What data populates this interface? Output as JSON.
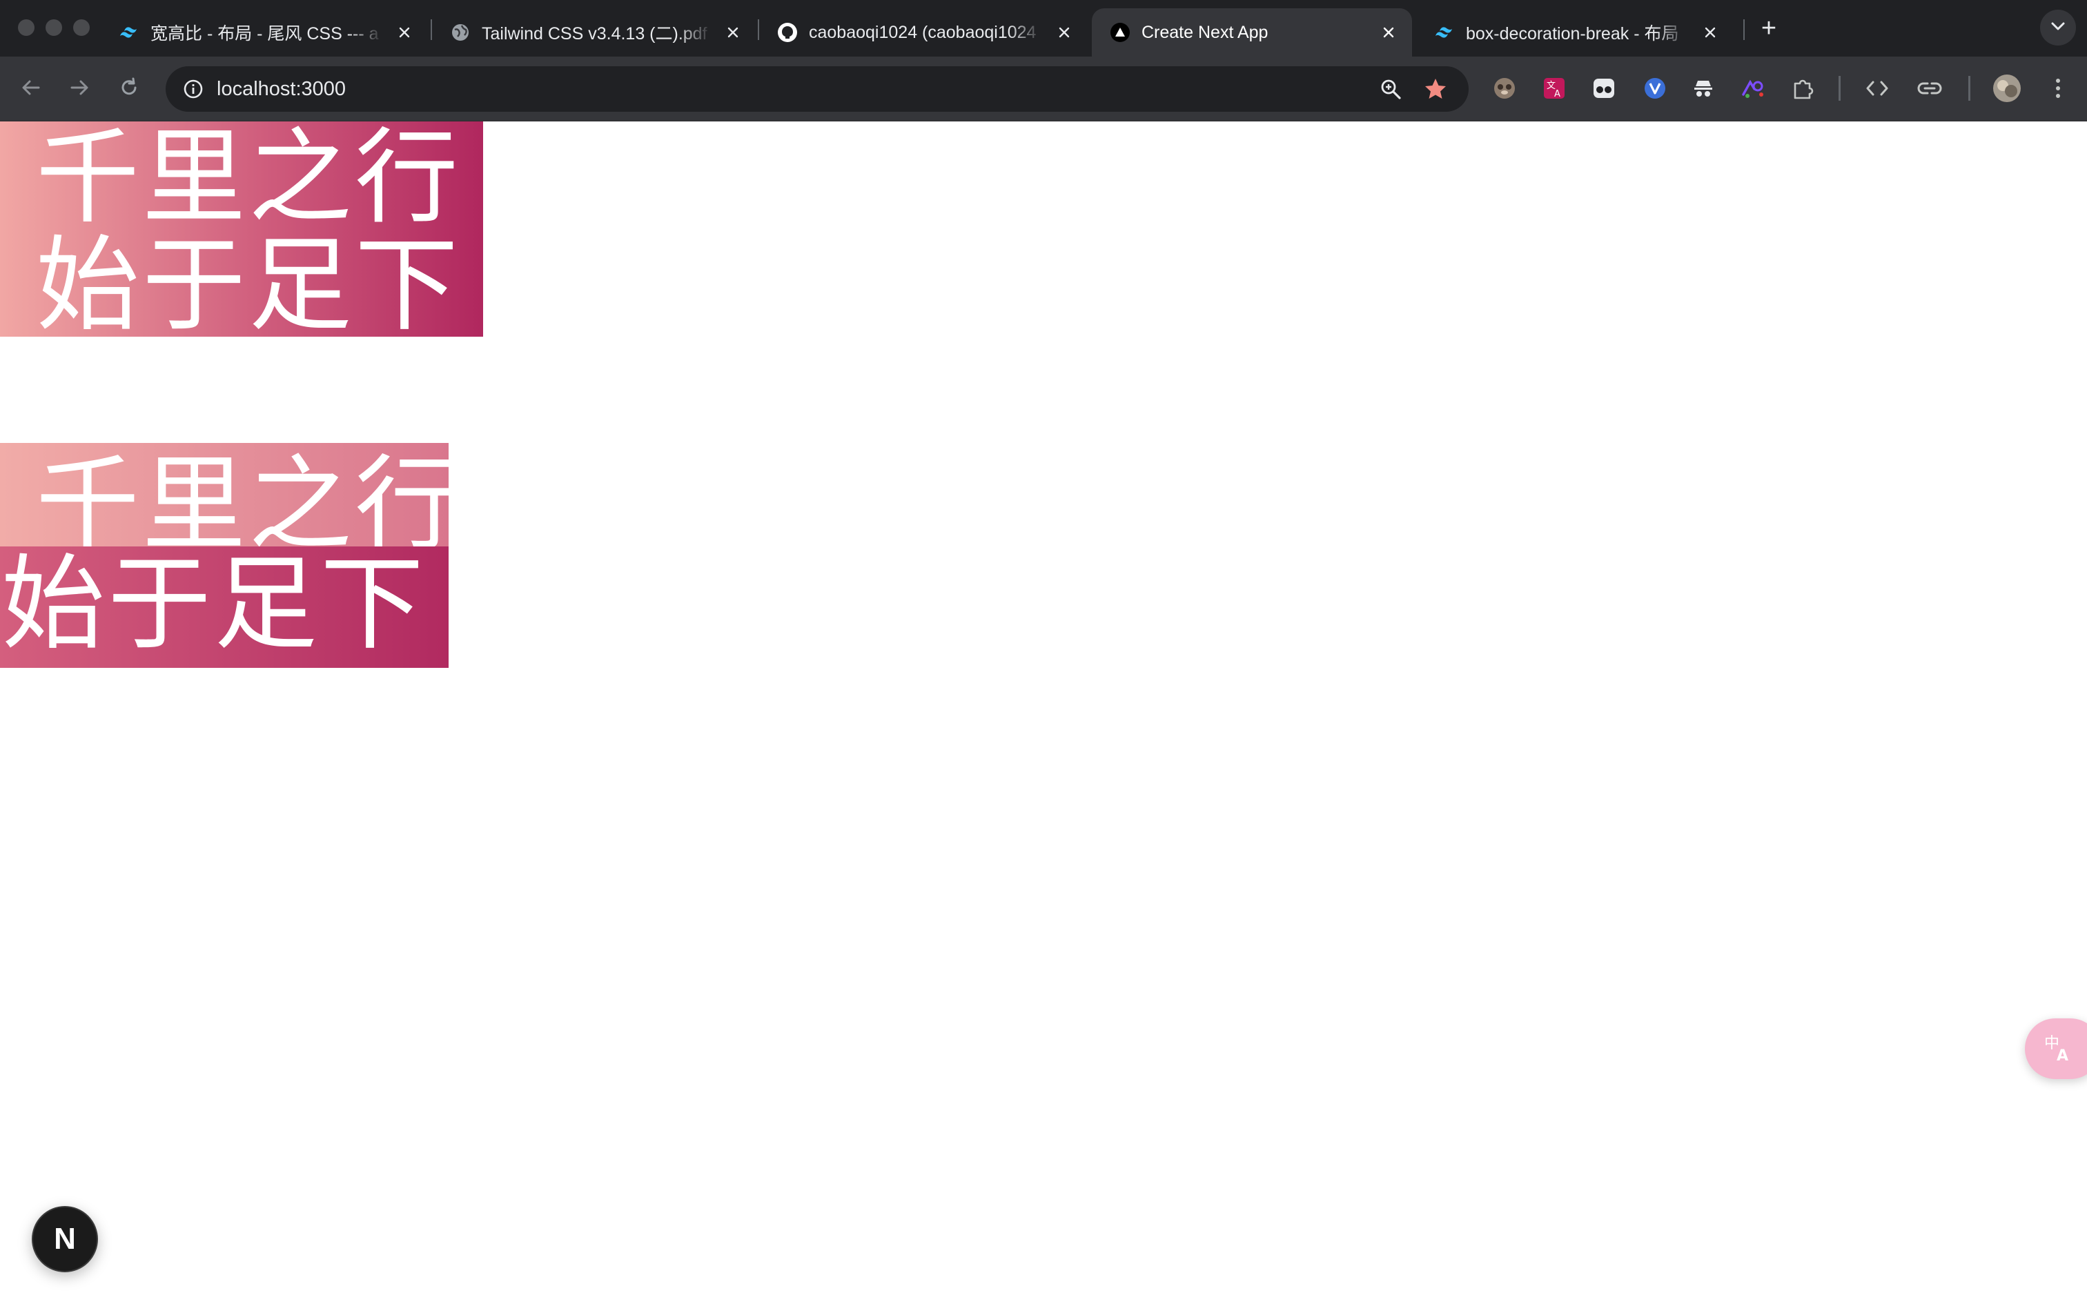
{
  "browser": {
    "tabs": [
      {
        "title": "宽高比 - 布局 - 尾风 CSS --- a",
        "icon": "tailwind-icon",
        "active": false
      },
      {
        "title": "Tailwind CSS v3.4.13 (二).pdf",
        "icon": "globe-icon",
        "active": false
      },
      {
        "title": "caobaoqi1024 (caobaoqi1024",
        "icon": "github-icon",
        "active": false
      },
      {
        "title": "Create Next App",
        "icon": "nextjs-icon",
        "active": true
      },
      {
        "title": "box-decoration-break - 布局",
        "icon": "tailwind-icon",
        "active": false
      }
    ],
    "new_tab_label": "+",
    "address_bar": {
      "url": "localhost:3000"
    },
    "star_color": "#f28b82",
    "extensions": [
      "sloth-extension-icon",
      "translate-extension-icon",
      "glasses-extension-icon",
      "vue-devtools-icon",
      "incognito-extension-icon",
      "toolbox-extension-icon",
      "puzzle-extensions-icon",
      "code-icon",
      "link-icon",
      "profile-avatar",
      "more-menu-icon"
    ]
  },
  "page": {
    "clone_block": {
      "line1": "千里之行",
      "line2": "始于足下",
      "gradient": [
        "#f1a7a4",
        "#b0275e"
      ]
    },
    "slice_block": {
      "line1": "千里之行",
      "line2": "始于足下",
      "gradient": [
        "#f1a7a4",
        "#b0275e"
      ]
    },
    "next_badge_label": "N",
    "translate_fab_icon": "translate-icon"
  }
}
